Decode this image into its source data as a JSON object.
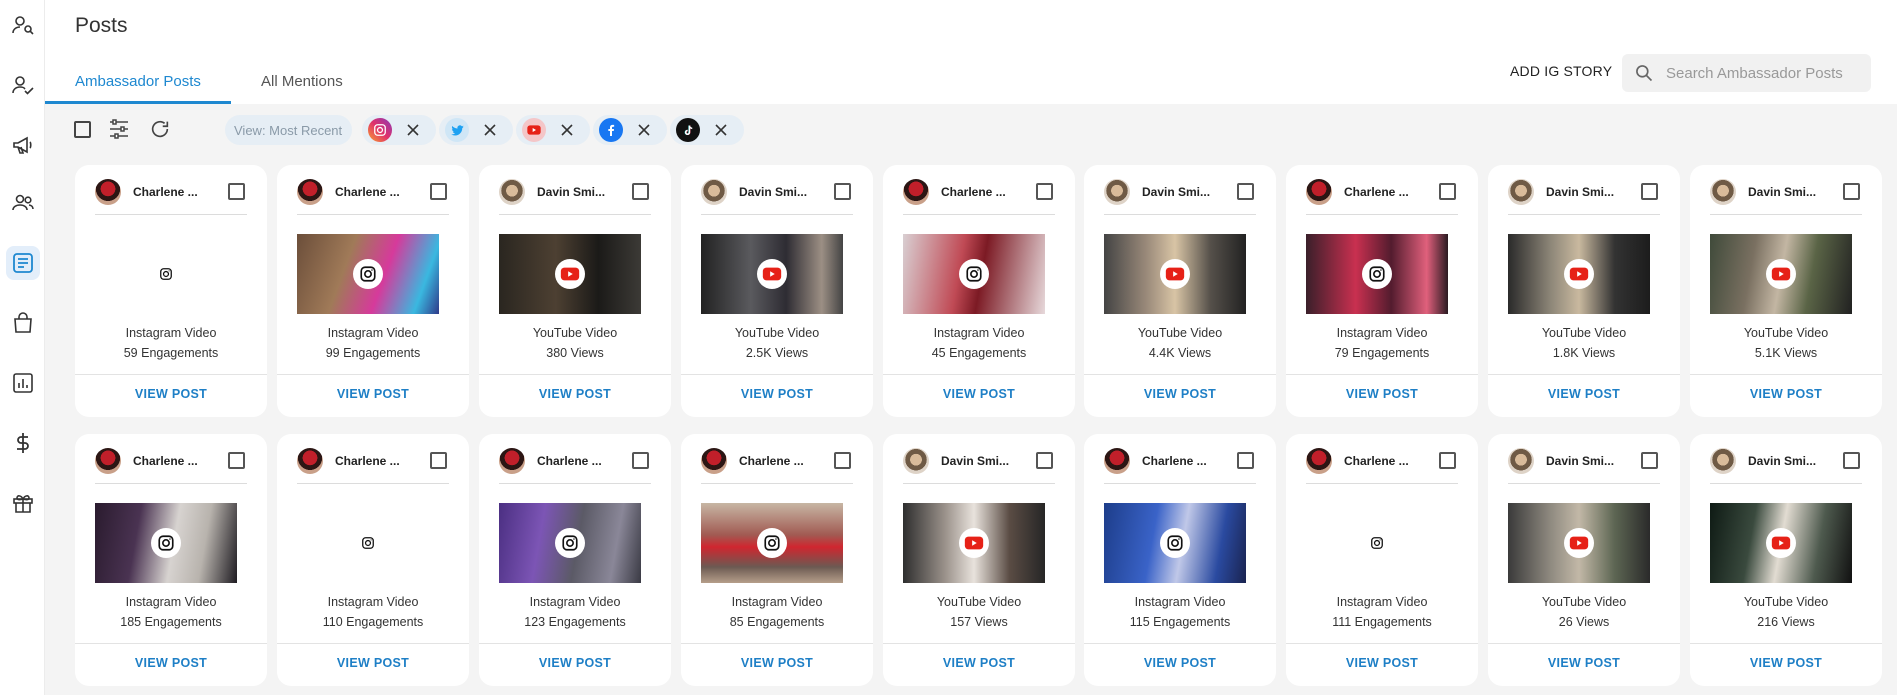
{
  "header": {
    "title": "Posts",
    "tabs": [
      {
        "label": "Ambassador Posts",
        "active": true
      },
      {
        "label": "All Mentions",
        "active": false
      }
    ],
    "add_story_label": "ADD IG STORY",
    "search_placeholder": "Search Ambassador Posts"
  },
  "sidebar": {
    "items": [
      {
        "icon": "user-search-icon"
      },
      {
        "icon": "user-check-icon"
      },
      {
        "icon": "megaphone-icon"
      },
      {
        "icon": "users-icon"
      },
      {
        "icon": "posts-icon",
        "active": true
      },
      {
        "icon": "shopping-bag-icon"
      },
      {
        "icon": "bar-chart-icon"
      },
      {
        "icon": "dollar-icon"
      },
      {
        "icon": "gift-icon"
      }
    ]
  },
  "toolbar": {
    "view_label": "View: Most Recent",
    "platform_filters": [
      "instagram",
      "twitter",
      "youtube",
      "facebook",
      "tiktok"
    ]
  },
  "colors": {
    "accent": "#1e88d0",
    "link": "#1e7fc6",
    "youtube": "#e62117",
    "facebook": "#1877f2",
    "twitter": "#1da1f2"
  },
  "view_post_label": "VIEW POST",
  "posts": [
    {
      "author": "Charlene ...",
      "type": "Instagram Video",
      "metric": "59 Engagements",
      "platform": "instagram",
      "thumbnail": false
    },
    {
      "author": "Charlene ...",
      "type": "Instagram Video",
      "metric": "99 Engagements",
      "platform": "instagram",
      "thumbnail": true
    },
    {
      "author": "Davin Smi...",
      "type": "YouTube Video",
      "metric": "380 Views",
      "platform": "youtube",
      "thumbnail": true
    },
    {
      "author": "Davin Smi...",
      "type": "YouTube Video",
      "metric": "2.5K Views",
      "platform": "youtube",
      "thumbnail": true
    },
    {
      "author": "Charlene ...",
      "type": "Instagram Video",
      "metric": "45 Engagements",
      "platform": "instagram",
      "thumbnail": true
    },
    {
      "author": "Davin Smi...",
      "type": "YouTube Video",
      "metric": "4.4K Views",
      "platform": "youtube",
      "thumbnail": true
    },
    {
      "author": "Charlene ...",
      "type": "Instagram Video",
      "metric": "79 Engagements",
      "platform": "instagram",
      "thumbnail": true
    },
    {
      "author": "Davin Smi...",
      "type": "YouTube Video",
      "metric": "1.8K Views",
      "platform": "youtube",
      "thumbnail": true
    },
    {
      "author": "Davin Smi...",
      "type": "YouTube Video",
      "metric": "5.1K Views",
      "platform": "youtube",
      "thumbnail": true
    },
    {
      "author": "Charlene ...",
      "type": "Instagram Video",
      "metric": "185 Engagements",
      "platform": "instagram",
      "thumbnail": true
    },
    {
      "author": "Charlene ...",
      "type": "Instagram Video",
      "metric": "110 Engagements",
      "platform": "instagram",
      "thumbnail": false
    },
    {
      "author": "Charlene ...",
      "type": "Instagram Video",
      "metric": "123 Engagements",
      "platform": "instagram",
      "thumbnail": true
    },
    {
      "author": "Charlene ...",
      "type": "Instagram Video",
      "metric": "85 Engagements",
      "platform": "instagram",
      "thumbnail": true
    },
    {
      "author": "Davin Smi...",
      "type": "YouTube Video",
      "metric": "157 Views",
      "platform": "youtube",
      "thumbnail": true
    },
    {
      "author": "Charlene ...",
      "type": "Instagram Video",
      "metric": "115 Engagements",
      "platform": "instagram",
      "thumbnail": true
    },
    {
      "author": "Charlene ...",
      "type": "Instagram Video",
      "metric": "111 Engagements",
      "platform": "instagram",
      "thumbnail": false
    },
    {
      "author": "Davin Smi...",
      "type": "YouTube Video",
      "metric": "26 Views",
      "platform": "youtube",
      "thumbnail": true
    },
    {
      "author": "Davin Smi...",
      "type": "YouTube Video",
      "metric": "216 Views",
      "platform": "youtube",
      "thumbnail": true
    }
  ]
}
